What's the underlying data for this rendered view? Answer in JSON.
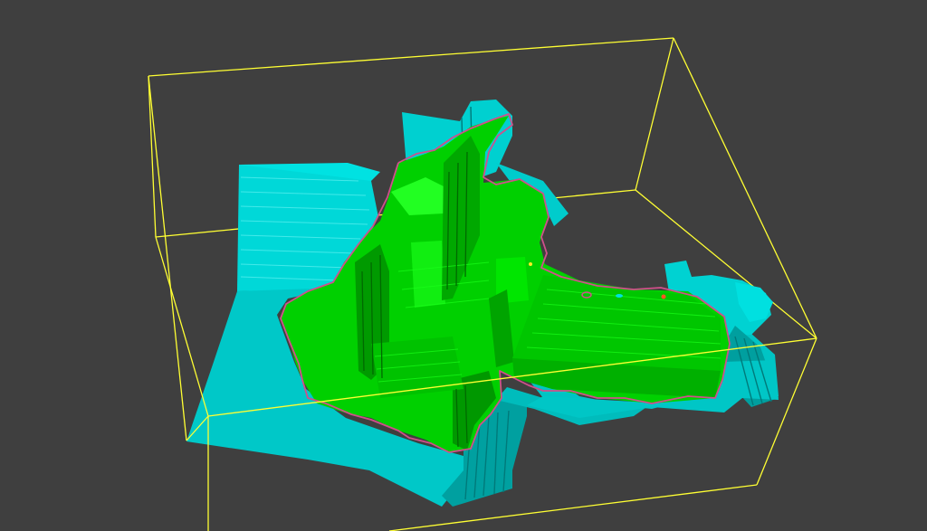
{
  "viewport": {
    "background_color": "#3f3f3f",
    "bounding_box_color": "#ffff33",
    "colors": {
      "wall": "#00d8d8",
      "wall_dark": "#00a9a9",
      "wall_shadow": "#008c8c",
      "terrain": "#00d400",
      "terrain_light": "#1fff1f",
      "terrain_dark": "#00a000",
      "outline": "#d0508a"
    },
    "objects": [
      "bounding-box",
      "cyan-walls",
      "green-terrain-mesh",
      "boundary-outline",
      "marker-points"
    ]
  }
}
